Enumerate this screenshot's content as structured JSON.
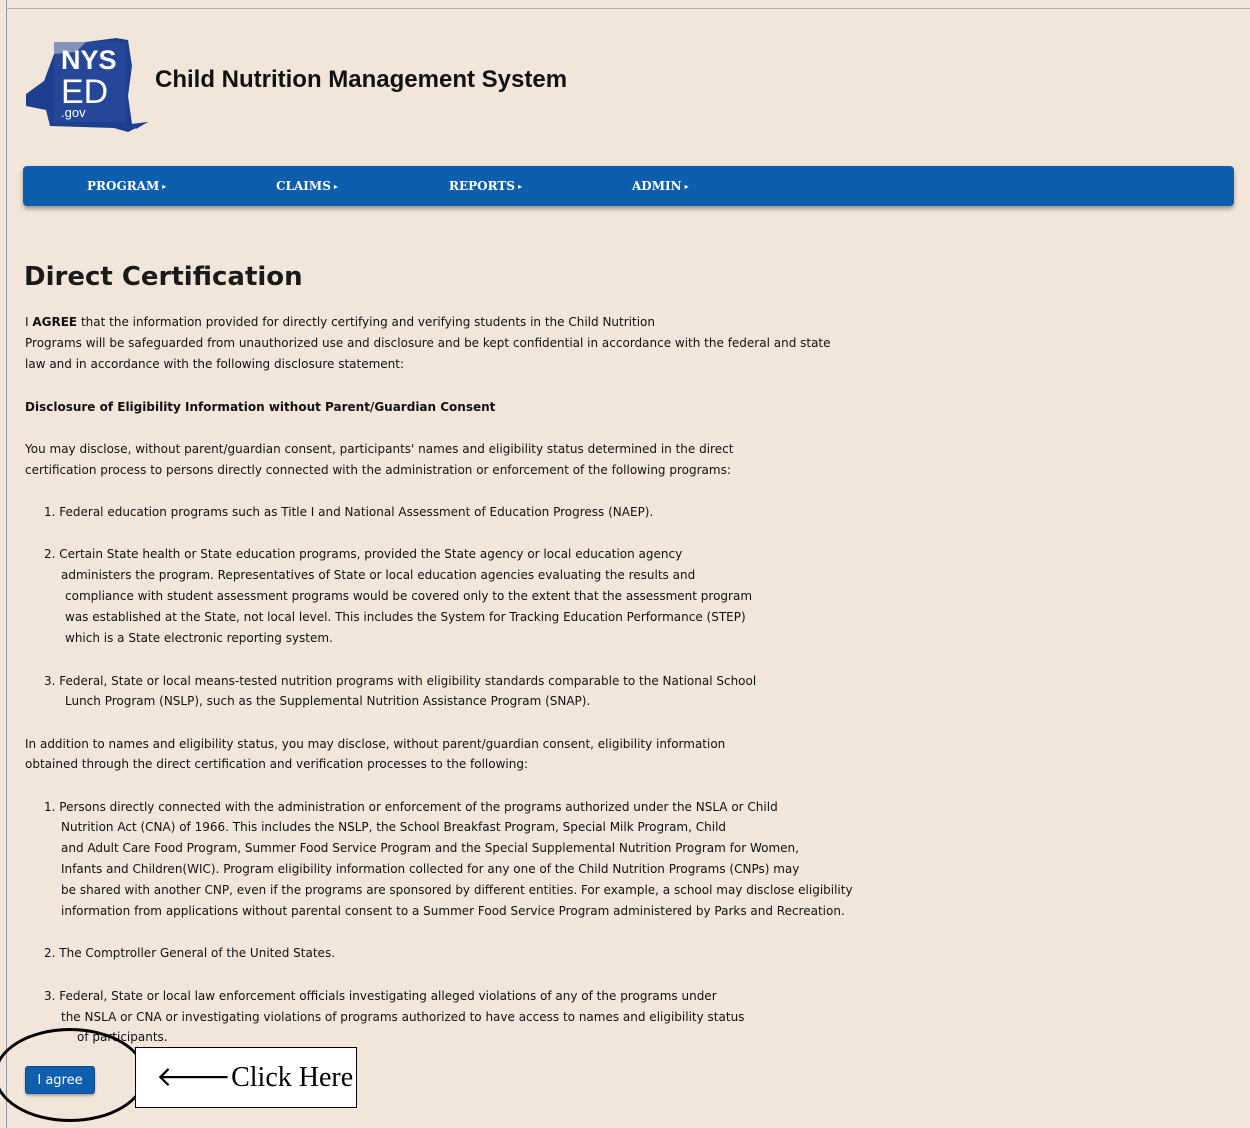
{
  "header": {
    "logo": {
      "line1": "NYS",
      "line2": "ED",
      "line3": ".gov"
    },
    "title": "Child Nutrition Management System"
  },
  "nav": [
    {
      "label": "PROGRAM"
    },
    {
      "label": "CLAIMS"
    },
    {
      "label": "REPORTS"
    },
    {
      "label": "ADMIN"
    }
  ],
  "page": {
    "title": "Direct Certification",
    "agree_intro_prefix": "I ",
    "agree_intro_bold": "AGREE",
    "agree_intro_l1_rest": " that the information provided for directly certifying and verifying students in the Child Nutrition",
    "agree_intro_l2": "Programs will be safeguarded from unauthorized use and disclosure and be kept confidential in accordance with the federal and state",
    "agree_intro_l3": "law and in accordance with the following disclosure statement:",
    "disclosure_heading": "Disclosure of Eligibility Information without Parent/Guardian Consent",
    "para1_l1": "You may disclose, without parent/guardian consent, participants' names and eligibility status determined in the direct",
    "para1_l2": "certification process to persons directly connected with the administration or enforcement of the following programs:",
    "list1": [
      {
        "lines": [
          "1. Federal education programs such as Title I and National Assessment of Education Progress (NAEP)."
        ]
      },
      {
        "lines": [
          "2. Certain State health or State education programs, provided the State agency or local education agency",
          "administers the program. Representatives of State or local education agencies evaluating the results and",
          "compliance with student assessment programs would be covered only to the extent that the assessment program",
          "was established at the State, not local level. This includes the System for Tracking Education Performance (STEP)",
          "which is a State electronic reporting system."
        ]
      },
      {
        "lines": [
          "3. Federal, State or local means-tested nutrition programs with eligibility standards comparable to the National School",
          "Lunch Program (NSLP), such as the Supplemental Nutrition Assistance Program (SNAP)."
        ]
      }
    ],
    "para2_l1": "In addition to names and eligibility status, you may disclose, without parent/guardian consent, eligibility information",
    "para2_l2": "obtained through the direct certification and verification processes to the following:",
    "list2": [
      {
        "lines": [
          "1. Persons directly connected with the administration or enforcement of the programs authorized under the NSLA or Child",
          "Nutrition Act (CNA) of 1966. This includes the NSLP, the School Breakfast Program, Special Milk Program, Child",
          "and Adult Care Food Program, Summer Food Service Program and the Special Supplemental Nutrition Program for Women,",
          "Infants and Children(WIC). Program eligibility information collected for any one of the Child Nutrition Programs (CNPs) may",
          "be shared with another CNP, even if the programs are sponsored by different entities. For example, a school may disclose eligibility",
          "information from applications without parental consent to a Summer Food Service Program administered by Parks and Recreation."
        ]
      },
      {
        "lines": [
          "2. The Comptroller General of the United States."
        ]
      },
      {
        "lines": [
          "3. Federal, State or local law enforcement officials investigating alleged violations of any of the programs under",
          "the NSLA or CNA or investigating violations of programs authorized to have access to names and eligibility status",
          "of participants."
        ]
      }
    ],
    "agree_button": "I agree",
    "callout_arrow": "🡐",
    "callout_text": "Click Here"
  },
  "colors": {
    "background": "#f2e6da",
    "nav_blue": "#0d5fad",
    "logo_blue": "#1d3f8f"
  }
}
